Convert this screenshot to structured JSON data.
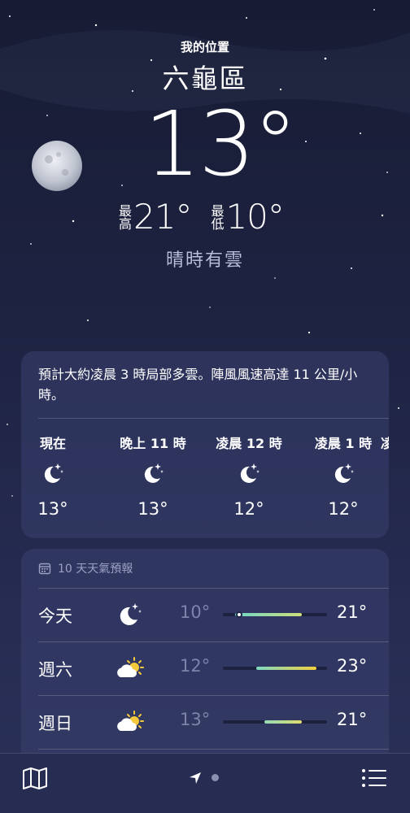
{
  "location": {
    "caption": "我的位置",
    "name": "六龜區"
  },
  "current": {
    "temp": "13°",
    "condition": "晴時有雲"
  },
  "hilo": {
    "high_label": "最高",
    "high": "21°",
    "low_label": "最低",
    "low": "10°"
  },
  "hourly": {
    "summary": "預計大約凌晨 3 時局部多雲。陣風風速高達 11 公里/小時。",
    "items": [
      {
        "label": "現在",
        "icon": "moon-stars-icon",
        "temp": "13°"
      },
      {
        "label": "晚上 11 時",
        "icon": "moon-stars-icon",
        "temp": "13°"
      },
      {
        "label": "凌晨 12 時",
        "icon": "moon-stars-icon",
        "temp": "12°"
      },
      {
        "label": "凌晨 1 時",
        "icon": "moon-stars-icon",
        "temp": "12°"
      },
      {
        "label": "凌",
        "icon": "moon-stars-icon",
        "temp": ""
      }
    ]
  },
  "forecast": {
    "title": "10 天天氣預報",
    "days": [
      {
        "day": "今天",
        "icon": "moon-stars-icon",
        "low": "10°",
        "high": "21°",
        "range_start": 0.12,
        "range_end": 0.76,
        "current_pos": 0.16,
        "colors": [
          "#6fd6c8",
          "#cfe07a"
        ]
      },
      {
        "day": "週六",
        "icon": "partly-cloudy-sun-icon",
        "low": "12°",
        "high": "23°",
        "range_start": 0.32,
        "range_end": 0.9,
        "colors": [
          "#7fd9c2",
          "#f2cf3e"
        ]
      },
      {
        "day": "週日",
        "icon": "partly-cloudy-sun-icon",
        "low": "13°",
        "high": "21°",
        "range_start": 0.4,
        "range_end": 0.76,
        "colors": [
          "#94dbb7",
          "#dfdc6a"
        ]
      }
    ]
  },
  "colors": {
    "accent": "#ffffff",
    "secondary": "#b8bdd8",
    "background": "#1e2342"
  }
}
